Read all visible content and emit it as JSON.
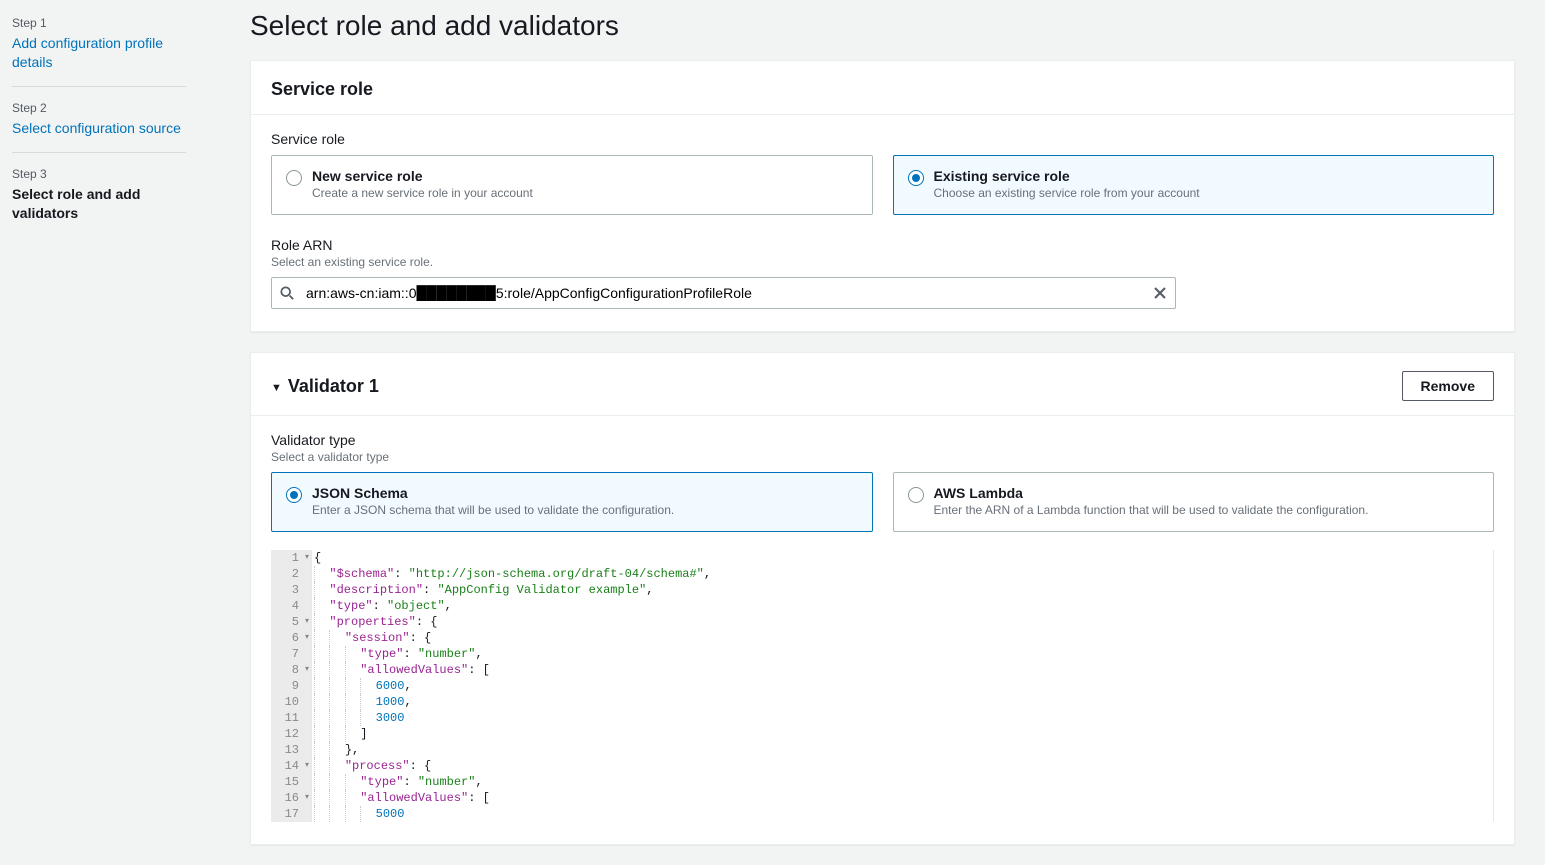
{
  "sidebar": {
    "steps": [
      {
        "label": "Step 1",
        "title": "Add configuration profile details",
        "state": "link"
      },
      {
        "label": "Step 2",
        "title": "Select configuration source",
        "state": "link"
      },
      {
        "label": "Step 3",
        "title": "Select role and add validators",
        "state": "current"
      }
    ]
  },
  "page": {
    "title": "Select role and add validators"
  },
  "service_role_panel": {
    "title": "Service role",
    "field_label": "Service role",
    "options": [
      {
        "title": "New service role",
        "desc": "Create a new service role in your account",
        "selected": false
      },
      {
        "title": "Existing service role",
        "desc": "Choose an existing service role from your account",
        "selected": true
      }
    ],
    "role_arn": {
      "label": "Role ARN",
      "hint": "Select an existing service role.",
      "value": "arn:aws-cn:iam::0████████5:role/AppConfigConfigurationProfileRole"
    }
  },
  "validator_panel": {
    "title": "Validator 1",
    "remove": "Remove",
    "type_label": "Validator type",
    "type_hint": "Select a validator type",
    "options": [
      {
        "title": "JSON Schema",
        "desc": "Enter a JSON schema that will be used to validate the configuration.",
        "selected": true
      },
      {
        "title": "AWS Lambda",
        "desc": "Enter the ARN of a Lambda function that will be used to validate the configuration.",
        "selected": false
      }
    ],
    "code": {
      "lines": [
        {
          "n": 1,
          "fold": true,
          "indent": 0,
          "tokens": [
            {
              "c": "p",
              "t": "{"
            }
          ]
        },
        {
          "n": 2,
          "fold": false,
          "indent": 1,
          "tokens": [
            {
              "c": "k",
              "t": "\"$schema\""
            },
            {
              "c": "p",
              "t": ": "
            },
            {
              "c": "s",
              "t": "\"http://json-schema.org/draft-04/schema#\""
            },
            {
              "c": "p",
              "t": ","
            }
          ]
        },
        {
          "n": 3,
          "fold": false,
          "indent": 1,
          "tokens": [
            {
              "c": "k",
              "t": "\"description\""
            },
            {
              "c": "p",
              "t": ": "
            },
            {
              "c": "s",
              "t": "\"AppConfig Validator example\""
            },
            {
              "c": "p",
              "t": ","
            }
          ]
        },
        {
          "n": 4,
          "fold": false,
          "indent": 1,
          "tokens": [
            {
              "c": "k",
              "t": "\"type\""
            },
            {
              "c": "p",
              "t": ": "
            },
            {
              "c": "s",
              "t": "\"object\""
            },
            {
              "c": "p",
              "t": ","
            }
          ]
        },
        {
          "n": 5,
          "fold": true,
          "indent": 1,
          "tokens": [
            {
              "c": "k",
              "t": "\"properties\""
            },
            {
              "c": "p",
              "t": ": {"
            }
          ]
        },
        {
          "n": 6,
          "fold": true,
          "indent": 2,
          "tokens": [
            {
              "c": "k",
              "t": "\"session\""
            },
            {
              "c": "p",
              "t": ": {"
            }
          ]
        },
        {
          "n": 7,
          "fold": false,
          "indent": 3,
          "tokens": [
            {
              "c": "k",
              "t": "\"type\""
            },
            {
              "c": "p",
              "t": ": "
            },
            {
              "c": "s",
              "t": "\"number\""
            },
            {
              "c": "p",
              "t": ","
            }
          ]
        },
        {
          "n": 8,
          "fold": true,
          "indent": 3,
          "tokens": [
            {
              "c": "k",
              "t": "\"allowedValues\""
            },
            {
              "c": "p",
              "t": ": ["
            }
          ]
        },
        {
          "n": 9,
          "fold": false,
          "indent": 4,
          "tokens": [
            {
              "c": "n",
              "t": "6000"
            },
            {
              "c": "p",
              "t": ","
            }
          ]
        },
        {
          "n": 10,
          "fold": false,
          "indent": 4,
          "tokens": [
            {
              "c": "n",
              "t": "1000"
            },
            {
              "c": "p",
              "t": ","
            }
          ]
        },
        {
          "n": 11,
          "fold": false,
          "indent": 4,
          "tokens": [
            {
              "c": "n",
              "t": "3000"
            }
          ]
        },
        {
          "n": 12,
          "fold": false,
          "indent": 3,
          "tokens": [
            {
              "c": "p",
              "t": "]"
            }
          ]
        },
        {
          "n": 13,
          "fold": false,
          "indent": 2,
          "tokens": [
            {
              "c": "p",
              "t": "},"
            }
          ]
        },
        {
          "n": 14,
          "fold": true,
          "indent": 2,
          "tokens": [
            {
              "c": "k",
              "t": "\"process\""
            },
            {
              "c": "p",
              "t": ": {"
            }
          ]
        },
        {
          "n": 15,
          "fold": false,
          "indent": 3,
          "tokens": [
            {
              "c": "k",
              "t": "\"type\""
            },
            {
              "c": "p",
              "t": ": "
            },
            {
              "c": "s",
              "t": "\"number\""
            },
            {
              "c": "p",
              "t": ","
            }
          ]
        },
        {
          "n": 16,
          "fold": true,
          "indent": 3,
          "tokens": [
            {
              "c": "k",
              "t": "\"allowedValues\""
            },
            {
              "c": "p",
              "t": ": ["
            }
          ]
        },
        {
          "n": 17,
          "fold": false,
          "indent": 4,
          "tokens": [
            {
              "c": "n",
              "t": "5000"
            }
          ]
        }
      ]
    }
  }
}
